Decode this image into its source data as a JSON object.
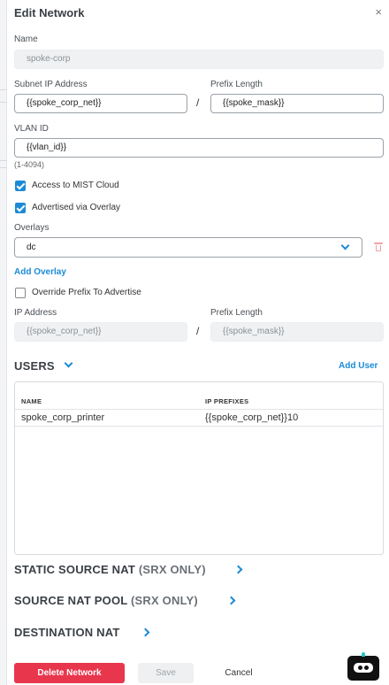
{
  "dialog": {
    "title": "Edit Network",
    "close_glyph": "×"
  },
  "fields": {
    "name_label": "Name",
    "name_value": "spoke-corp",
    "subnet_label": "Subnet IP Address",
    "subnet_value": "{{spoke_corp_net}}",
    "prefix_label": "Prefix Length",
    "prefix_value": "{{spoke_mask}}",
    "separator": "/",
    "vlan_label": "VLAN ID",
    "vlan_value": "{{vlan_id}}",
    "vlan_hint": "(1-4094)"
  },
  "checkboxes": {
    "access_mist": {
      "label": "Access to MIST Cloud",
      "checked": true
    },
    "advertised_overlay": {
      "label": "Advertised via Overlay",
      "checked": true
    },
    "override_prefix": {
      "label": "Override Prefix To Advertise",
      "checked": false
    }
  },
  "overlays": {
    "label": "Overlays",
    "selected": "dc",
    "add_link": "Add Overlay"
  },
  "advertise": {
    "ip_label": "IP Address",
    "ip_placeholder": "{{spoke_corp_net}}",
    "prefix_label": "Prefix Length",
    "prefix_placeholder": "{{spoke_mask}}"
  },
  "users": {
    "heading": "USERS",
    "add_link": "Add User",
    "columns": [
      "NAME",
      "IP PREFIXES"
    ],
    "rows": [
      {
        "name": "spoke_corp_printer",
        "prefix": "{{spoke_corp_net}}10"
      }
    ]
  },
  "sections": {
    "static_nat": {
      "title": "STATIC SOURCE NAT",
      "suffix": "(SRX ONLY)"
    },
    "nat_pool": {
      "title": "SOURCE NAT POOL",
      "suffix": "(SRX ONLY)"
    },
    "dest_nat": {
      "title": "DESTINATION NAT"
    }
  },
  "footer": {
    "delete_label": "Delete Network",
    "save_label": "Save",
    "cancel_label": "Cancel"
  },
  "icons": {
    "close": "close-icon",
    "dropdown": "chevron-down-icon",
    "delete_overlay": "trash-icon",
    "section_expand": "chevron-right-icon",
    "assistant": "chatbot-icon"
  },
  "colors": {
    "accent": "#1b8bd8",
    "danger": "#e8364d"
  }
}
